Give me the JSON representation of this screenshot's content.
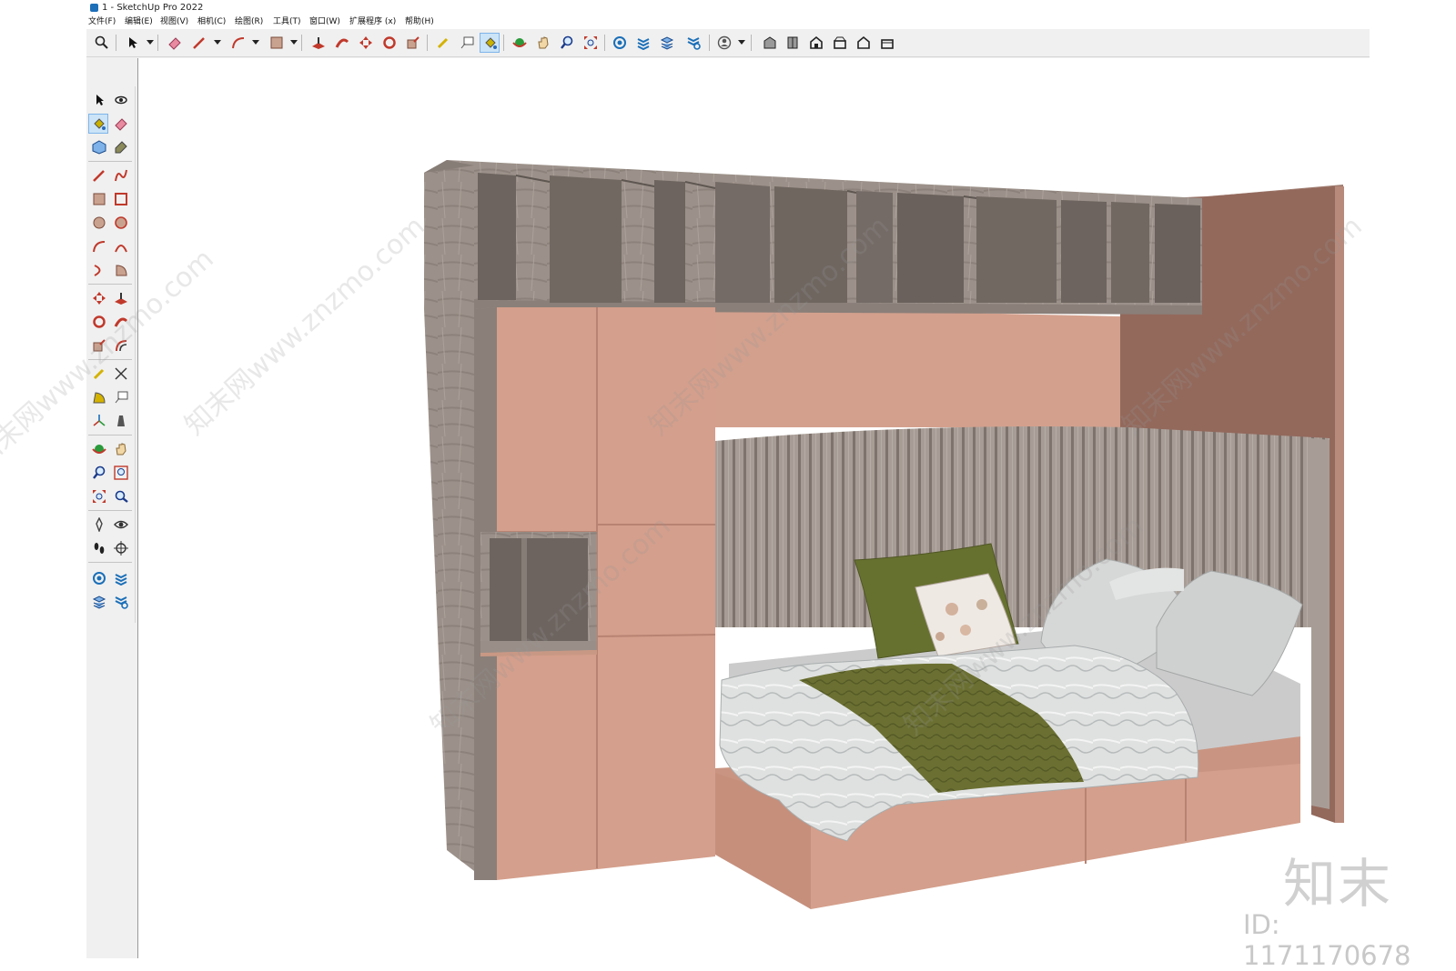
{
  "window": {
    "title": "1 - SketchUp Pro 2022"
  },
  "menu": {
    "file": "文件(F)",
    "edit": "编辑(E)",
    "view": "视图(V)",
    "camera": "相机(C)",
    "draw": "绘图(R)",
    "tools": "工具(T)",
    "window": "窗口(W)",
    "extensions": "扩展程序 (x)",
    "help": "帮助(H)"
  },
  "toolbar_icons": [
    "zoom-extents",
    "select",
    "eraser",
    "pencil",
    "arc",
    "rectangle",
    "push-pull",
    "follow-me",
    "move",
    "rotate",
    "scale",
    "tape-measure",
    "text",
    "paint-bucket",
    "orbit",
    "pan",
    "zoom",
    "zoom-window",
    "3d-warehouse",
    "extension-warehouse",
    "layout",
    "extension-manager",
    "account",
    "iso-view",
    "top-view",
    "front-view",
    "right-view",
    "back-view",
    "left-view"
  ],
  "left_toolbar_icons": [
    "select",
    "orbit",
    "paint-bucket",
    "eraser",
    "component",
    "tag",
    "line",
    "freehand",
    "rectangle",
    "rotated-rectangle",
    "circle",
    "polygon",
    "arc",
    "2-point-arc",
    "3-point-arc",
    "pie",
    "move",
    "push-pull",
    "rotate",
    "follow-me",
    "scale",
    "offset",
    "tape-measure",
    "dimension",
    "protractor",
    "text",
    "axes",
    "3d-text",
    "orbit",
    "pan",
    "zoom",
    "zoom-window",
    "zoom-extents",
    "previous",
    "walk",
    "look-around",
    "position-camera",
    "section-plane",
    "3d-warehouse",
    "extension-warehouse",
    "layout",
    "extension-manager"
  ],
  "watermark": {
    "brand": "知末",
    "id": "ID: 1171170678",
    "site": "知末网www.znzmo.com"
  },
  "colors": {
    "salmon": "#d49f8c",
    "salmon_dark": "#b88372",
    "wood_gray": "#9a8f88",
    "wall_side": "#946c5e",
    "olive": "#6b7032",
    "selection": "#cce4f7"
  }
}
